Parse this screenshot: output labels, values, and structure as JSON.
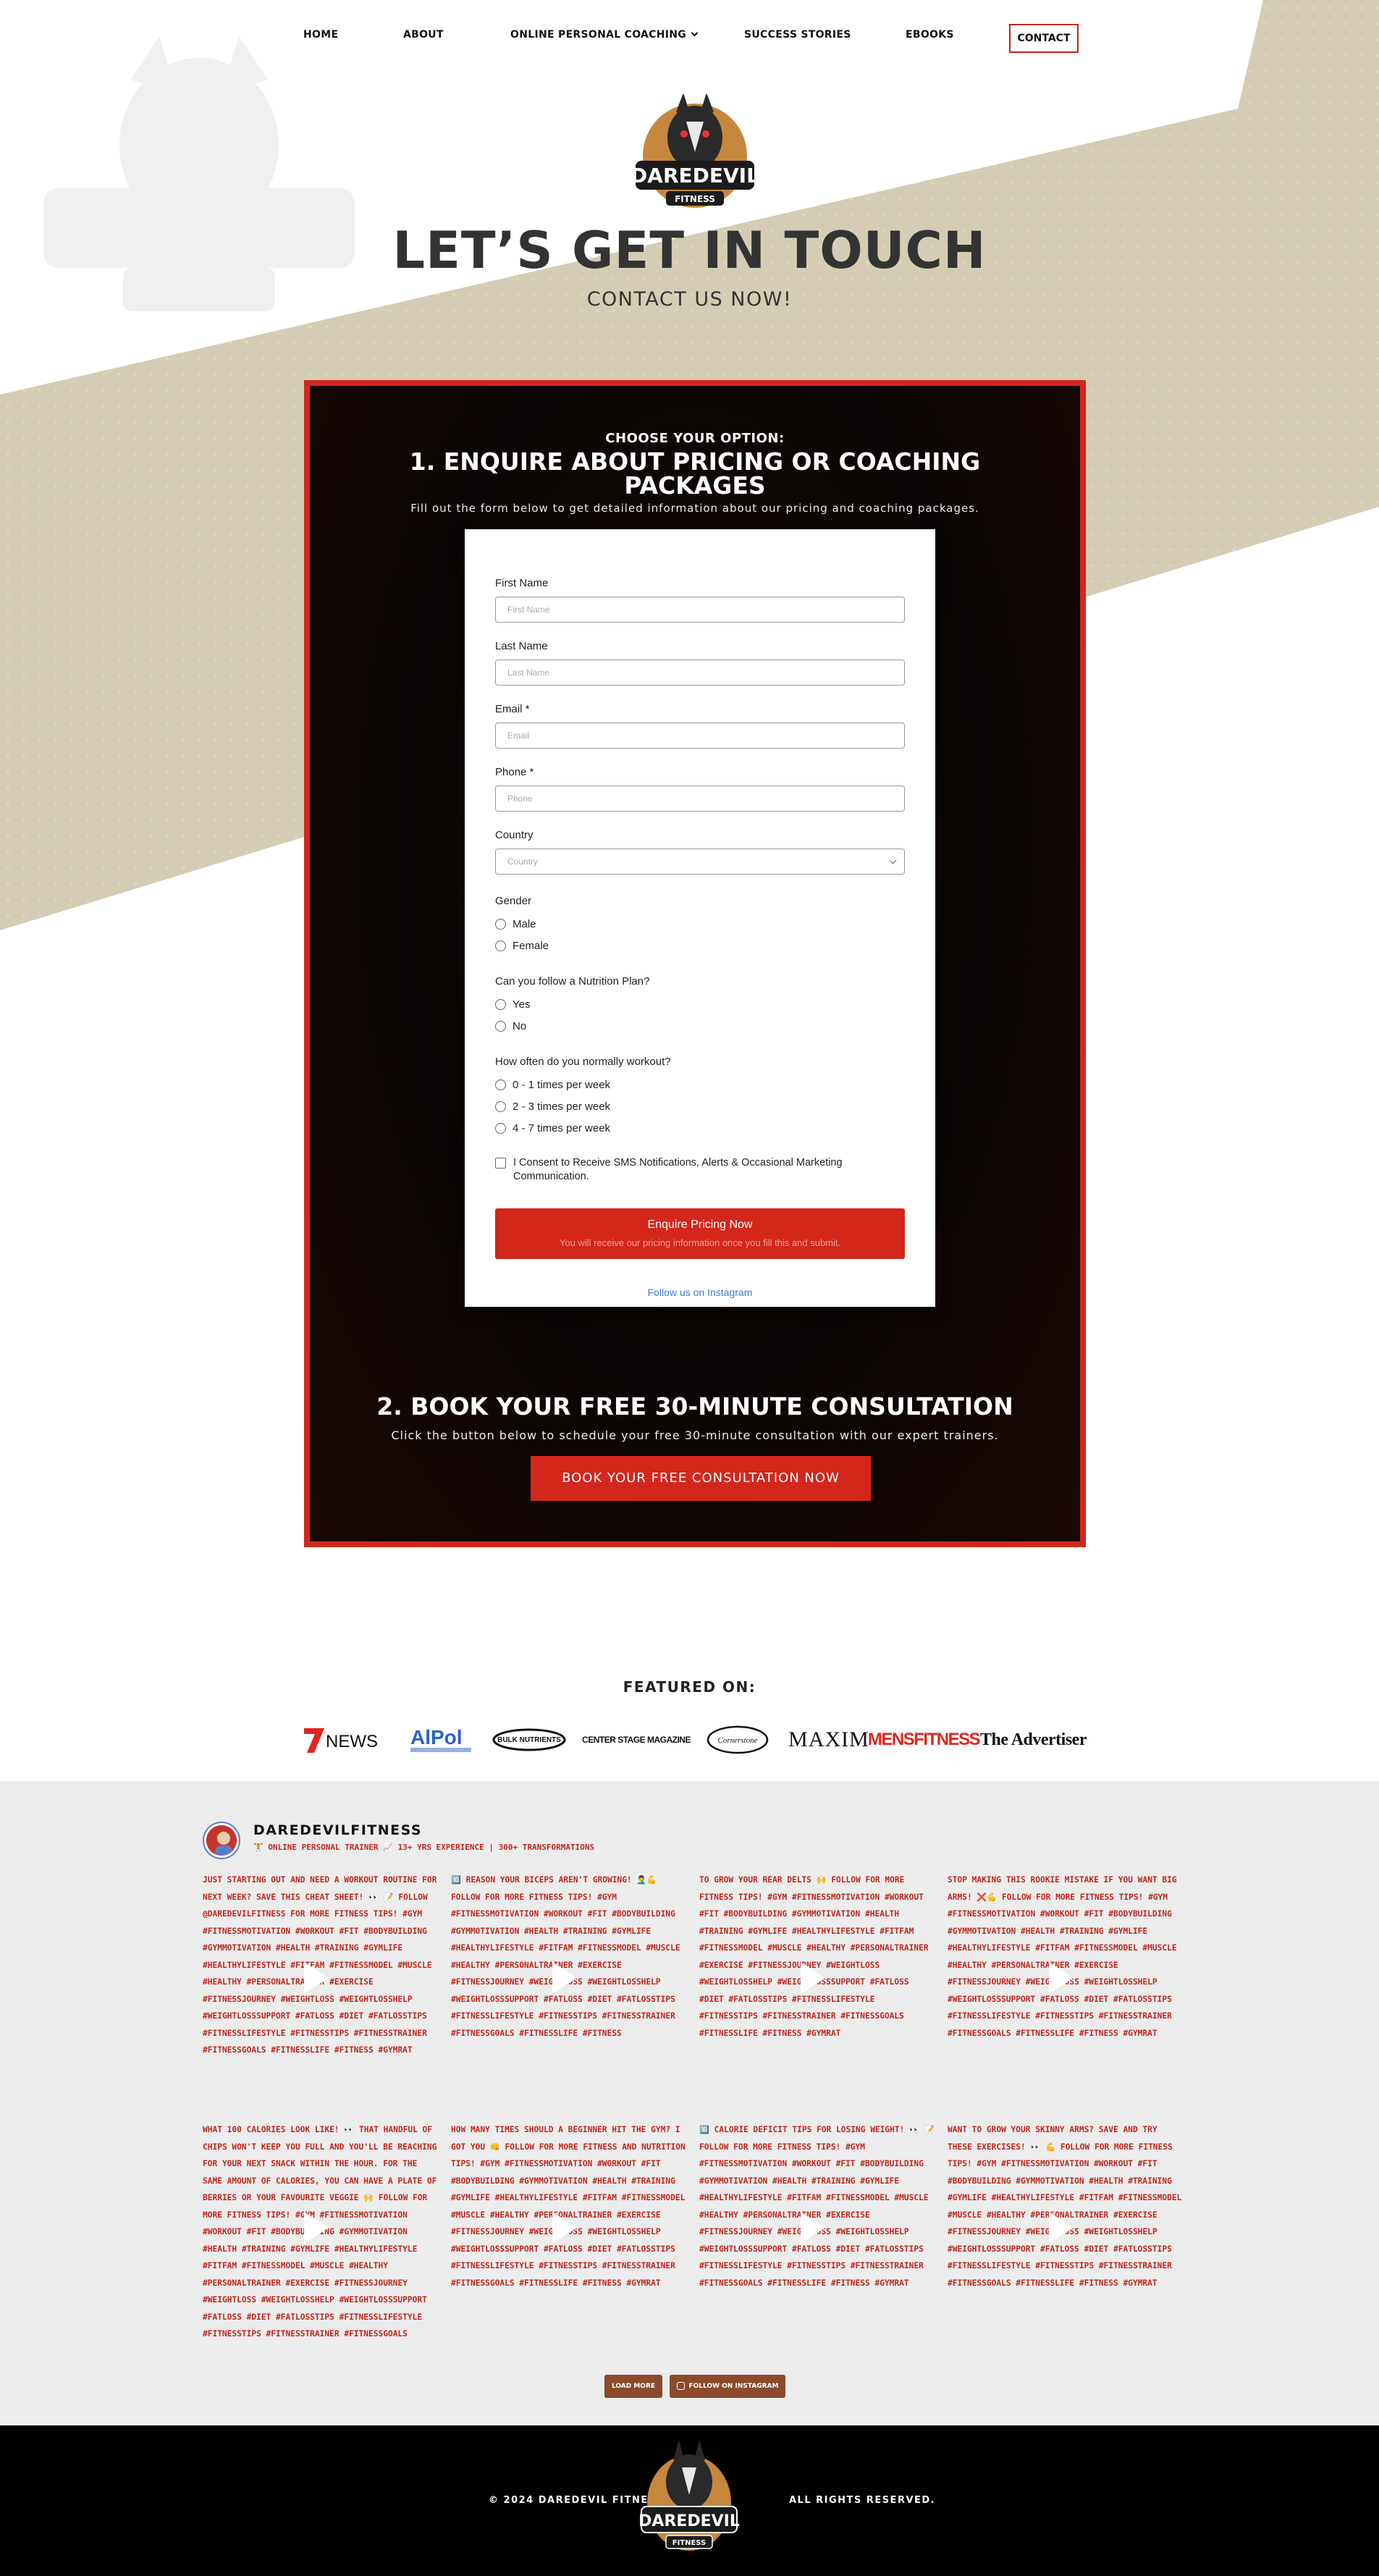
{
  "nav": {
    "home": "HOME",
    "about": "ABOUT",
    "coaching": "ONLINE PERSONAL COACHING",
    "stories": "SUCCESS STORIES",
    "ebooks": "EBOOKS",
    "contact": "CONTACT"
  },
  "logo_text": "DAREDEVIL FITNESS",
  "hero": {
    "title": "LET’S GET IN TOUCH",
    "subtitle": "CONTACT US NOW!"
  },
  "option1": {
    "choose": "CHOOSE YOUR OPTION:",
    "title": "1. ENQUIRE ABOUT PRICING OR COACHING PACKAGES",
    "description": "Fill out the form below to get detailed information about our pricing and coaching packages."
  },
  "form": {
    "first_name_label": "First Name",
    "first_name_placeholder": "First Name",
    "last_name_label": "Last Name",
    "last_name_placeholder": "Last Name",
    "email_label": "Email *",
    "email_placeholder": "Email",
    "phone_label": "Phone *",
    "phone_placeholder": "Phone",
    "country_label": "Country",
    "country_placeholder": "Country",
    "gender_label": "Gender",
    "gender_options": [
      "Male",
      "Female"
    ],
    "nutrition_label": "Can you follow a Nutrition Plan?",
    "nutrition_options": [
      "Yes",
      "No"
    ],
    "workout_label": "How often do you normally workout?",
    "workout_options": [
      "0 - 1 times per week",
      "2 - 3 times per week",
      "4 - 7 times per week"
    ],
    "consent": "I Consent to Receive SMS Notifications, Alerts & Occasional Marketing Communication.",
    "submit_label": "Enquire Pricing Now",
    "submit_sub": "You will receive our pricing information once you fill this and submit.",
    "follow_link": "Follow us on Instagram"
  },
  "option2": {
    "title": "2. BOOK YOUR FREE 30-MINUTE CONSULTATION",
    "description": "Click the button below to schedule your free 30-minute consultation with our expert trainers.",
    "button": "BOOK YOUR FREE CONSULTATION NOW"
  },
  "featured": {
    "title": "FEATURED ON:",
    "logos": [
      "7NEWS",
      "AlPol",
      "BULK NUTRIENTS",
      "CENTER STAGE MAGAZINE",
      "Cornerstone",
      "MAXIM",
      "MENSFITNESS",
      "The Advertiser"
    ]
  },
  "instagram": {
    "username": "DAREDEVILFITNESS",
    "bio": "🏋️ ONLINE PERSONAL TRAINER 📈 13+ YRS EXPERIENCE | 300+ TRANSFORMATIONS",
    "posts": [
      "JUST STARTING OUT AND NEED A WORKOUT ROUTINE FOR NEXT WEEK? SAVE THIS CHEAT SHEET! 👀 📝 FOLLOW @DAREDEVILFITNESS FOR MORE FITNESS TIPS! #GYM #FITNESSMOTIVATION #WORKOUT #FIT #BODYBUILDING #GYMMOTIVATION #HEALTH #TRAINING #GYMLIFE #HEALTHYLIFESTYLE #FITFAM #FITNESSMODEL #MUSCLE #HEALTHY #PERSONALTRAINER #EXERCISE #FITNESSJOURNEY #WEIGHTLOSS #WEIGHTLOSSHELP #WEIGHTLOSSSUPPORT #FATLOSS #DIET #FATLOSSTIPS #FITNESSLIFESTYLE #FITNESSTIPS #FITNESSTRAINER #FITNESSGOALS #FITNESSLIFE #FITNESS #GYMRAT",
      "🔟 REASON YOUR BICEPS AREN'T GROWING! 🤦‍♂️💪 FOLLOW FOR MORE FITNESS TIPS! #GYM #FITNESSMOTIVATION #WORKOUT #FIT #BODYBUILDING #GYMMOTIVATION #HEALTH #TRAINING #GYMLIFE #HEALTHYLIFESTYLE #FITFAM #FITNESSMODEL #MUSCLE #HEALTHY #PERSONALTRAINER #EXERCISE #FITNESSJOURNEY #WEIGHTLOSS #WEIGHTLOSSHELP #WEIGHTLOSSSUPPORT #FATLOSS #DIET #FATLOSSTIPS #FITNESSLIFESTYLE #FITNESSTIPS #FITNESSTRAINER #FITNESSGOALS #FITNESSLIFE #FITNESS",
      "TO GROW YOUR REAR DELTS 🙌 FOLLOW FOR MORE FITNESS TIPS! #GYM #FITNESSMOTIVATION #WORKOUT #FIT #BODYBUILDING #GYMMOTIVATION #HEALTH #TRAINING #GYMLIFE #HEALTHYLIFESTYLE #FITFAM #FITNESSMODEL #MUSCLE #HEALTHY #PERSONALTRAINER #EXERCISE #FITNESSJOURNEY #WEIGHTLOSS #WEIGHTLOSSHELP #WEIGHTLOSSSUPPORT #FATLOSS #DIET #FATLOSSTIPS #FITNESSLIFESTYLE #FITNESSTIPS #FITNESSTRAINER #FITNESSGOALS #FITNESSLIFE #FITNESS #GYMRAT",
      "STOP MAKING THIS ROOKIE MISTAKE IF YOU WANT BIG ARMS! ❌💪 FOLLOW FOR MORE FITNESS TIPS! #GYM #FITNESSMOTIVATION #WORKOUT #FIT #BODYBUILDING #GYMMOTIVATION #HEALTH #TRAINING #GYMLIFE #HEALTHYLIFESTYLE #FITFAM #FITNESSMODEL #MUSCLE #HEALTHY #PERSONALTRAINER #EXERCISE #FITNESSJOURNEY #WEIGHTLOSS #WEIGHTLOSSHELP #WEIGHTLOSSSUPPORT #FATLOSS #DIET #FATLOSSTIPS #FITNESSLIFESTYLE #FITNESSTIPS #FITNESSTRAINER #FITNESSGOALS #FITNESSLIFE #FITNESS #GYMRAT",
      "WHAT 100 CALORIES LOOK LIKE! 👀 THAT HANDFUL OF CHIPS WON'T KEEP YOU FULL AND YOU'LL BE REACHING FOR YOUR NEXT SNACK WITHIN THE HOUR. FOR THE SAME AMOUNT OF CALORIES, YOU CAN HAVE A PLATE OF BERRIES OR YOUR FAVOURITE VEGGIE 🙌 FOLLOW FOR MORE FITNESS TIPS! #GYM #FITNESSMOTIVATION #WORKOUT #FIT #BODYBUILDING #GYMMOTIVATION #HEALTH #TRAINING #GYMLIFE #HEALTHYLIFESTYLE #FITFAM #FITNESSMODEL #MUSCLE #HEALTHY #PERSONALTRAINER #EXERCISE #FITNESSJOURNEY #WEIGHTLOSS #WEIGHTLOSSHELP #WEIGHTLOSSSUPPORT #FATLOSS #DIET #FATLOSSTIPS #FITNESSLIFESTYLE #FITNESSTIPS #FITNESSTRAINER #FITNESSGOALS #FITNESSLIFE #FITNESS #GYMRAT",
      "HOW MANY TIMES SHOULD A BEGINNER HIT THE GYM? I GOT YOU 👊 FOLLOW FOR MORE FITNESS AND NUTRITION TIPS! #GYM #FITNESSMOTIVATION #WORKOUT #FIT #BODYBUILDING #GYMMOTIVATION #HEALTH #TRAINING #GYMLIFE #HEALTHYLIFESTYLE #FITFAM #FITNESSMODEL #MUSCLE #HEALTHY #PERSONALTRAINER #EXERCISE #FITNESSJOURNEY #WEIGHTLOSS #WEIGHTLOSSHELP #WEIGHTLOSSSUPPORT #FATLOSS #DIET #FATLOSSTIPS #FITNESSLIFESTYLE #FITNESSTIPS #FITNESSTRAINER #FITNESSGOALS #FITNESSLIFE #FITNESS #GYMRAT",
      "🔟 CALORIE DEFICIT TIPS FOR LOSING WEIGHT! 👀 📝 FOLLOW FOR MORE FITNESS TIPS! #GYM #FITNESSMOTIVATION #WORKOUT #FIT #BODYBUILDING #GYMMOTIVATION #HEALTH #TRAINING #GYMLIFE #HEALTHYLIFESTYLE #FITFAM #FITNESSMODEL #MUSCLE #HEALTHY #PERSONALTRAINER #EXERCISE #FITNESSJOURNEY #WEIGHTLOSS #WEIGHTLOSSHELP #WEIGHTLOSSSUPPORT #FATLOSS #DIET #FATLOSSTIPS #FITNESSLIFESTYLE #FITNESSTIPS #FITNESSTRAINER #FITNESSGOALS #FITNESSLIFE #FITNESS #GYMRAT",
      "WANT TO GROW YOUR SKINNY ARMS? SAVE AND TRY THESE EXERCISES! 👀 💪 FOLLOW FOR MORE FITNESS TIPS! #GYM #FITNESSMOTIVATION #WORKOUT #FIT #BODYBUILDING #GYMMOTIVATION #HEALTH #TRAINING #GYMLIFE #HEALTHYLIFESTYLE #FITFAM #FITNESSMODEL #MUSCLE #HEALTHY #PERSONALTRAINER #EXERCISE #FITNESSJOURNEY #WEIGHTLOSS #WEIGHTLOSSHELP #WEIGHTLOSSSUPPORT #FATLOSS #DIET #FATLOSSTIPS #FITNESSLIFESTYLE #FITNESSTIPS #FITNESSTRAINER #FITNESSGOALS #FITNESSLIFE #FITNESS #GYMRAT"
    ],
    "load_more": "LOAD MORE",
    "follow_button": "FOLLOW ON INSTAGRAM"
  },
  "footer": {
    "copyright": "© 2024 DAREDEVIL FITNESS.",
    "rights": "ALL RIGHTS RESERVED."
  },
  "colors": {
    "accent_red": "#d3271c",
    "hero_band": "#d4cdb4",
    "dark_panel": "#0c0605",
    "instagram_bg": "#ececec",
    "instagram_button": "#8b4a2b",
    "link_blue": "#3b7bd6"
  }
}
